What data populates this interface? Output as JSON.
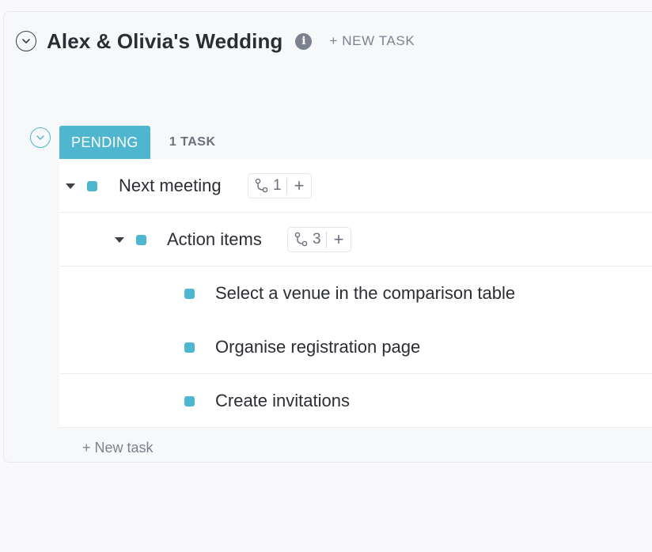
{
  "list": {
    "title": "Alex & Olivia's Wedding",
    "info_glyph": "i",
    "new_task_label": "+ NEW TASK"
  },
  "group": {
    "status_label": "PENDING",
    "status_color": "#4fb6d0",
    "task_count": "1 TASK"
  },
  "tasks": [
    {
      "name": "Next meeting",
      "subtask_count": "1",
      "add": "+"
    },
    {
      "name": "Action items",
      "subtask_count": "3",
      "add": "+"
    },
    {
      "name": "Select a venue in the comparison table"
    },
    {
      "name": "Organise registration page"
    },
    {
      "name": "Create invitations"
    }
  ],
  "footer": {
    "new_task_label": "+ New task"
  },
  "icons": {
    "collapse": "chevron-down-circle-icon",
    "info": "info-icon",
    "caret": "caret-down-icon",
    "subtasks": "subtask-branch-icon",
    "add": "plus-icon"
  }
}
